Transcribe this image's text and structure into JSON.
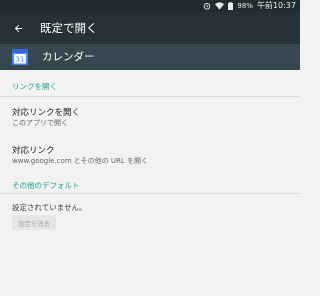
{
  "status_bar": {
    "battery": "98%",
    "time": "午前10:37"
  },
  "toolbar": {
    "title": "既定で開く",
    "back_icon": "arrow-back-icon"
  },
  "app": {
    "name": "カレンダー",
    "icon_day": "31",
    "icon": "calendar-icon",
    "icon_color": "#4285f4"
  },
  "sections": {
    "open_links_header": "リンクを開く",
    "defaults_header": "その他のデフォルト"
  },
  "items": {
    "open_supported": {
      "title": "対応リンクを開く",
      "summary": "このアプリで開く"
    },
    "supported_links": {
      "title": "対応リンク",
      "summary": "www.google.com とその他の URL を開く"
    }
  },
  "defaults": {
    "none_set_text": "設定されていません。",
    "clear_button_label": "設定を消去"
  },
  "colors": {
    "accent": "#1e9e8c",
    "toolbar": "#263238",
    "app_header": "#37474f",
    "background": "#f2f2f2"
  }
}
